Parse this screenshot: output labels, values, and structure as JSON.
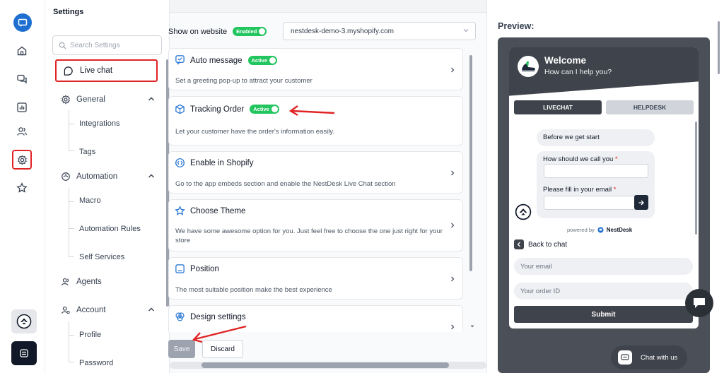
{
  "rail": {
    "items": [
      "logo-icon",
      "home-icon",
      "chat-icon",
      "reports-icon",
      "users-icon",
      "settings-icon",
      "star-icon"
    ]
  },
  "settings": {
    "title": "Settings",
    "search_placeholder": "Search Settings",
    "nav": {
      "live_chat": "Live chat",
      "general": "General",
      "integrations": "Integrations",
      "tags": "Tags",
      "automation": "Automation",
      "macro": "Macro",
      "automation_rules": "Automation Rules",
      "self_services": "Self Services",
      "agents": "Agents",
      "account": "Account",
      "profile": "Profile",
      "password": "Password"
    }
  },
  "main": {
    "show_on_website": "Show on website",
    "enabled_toggle": "Enabled",
    "store_url": "nestdesk-demo-3.myshopify.com",
    "cards": [
      {
        "title": "Auto message",
        "badge": "Active",
        "desc": "Set a greeting pop-up to attract your customer"
      },
      {
        "title": "Tracking Order",
        "badge": "Active",
        "desc": "Let your customer have the order's information easily."
      },
      {
        "title": "Enable in Shopify",
        "desc": "Go to the app embeds section and enable the NestDesk Live Chat section"
      },
      {
        "title": "Choose Theme",
        "desc": "We have some awesome option for you. Just feel free to choose the one just right for your store"
      },
      {
        "title": "Position",
        "desc": "The most suitable position make the best experience"
      },
      {
        "title": "Design settings"
      }
    ],
    "save": "Save",
    "discard": "Discard"
  },
  "preview": {
    "label": "Preview:",
    "welcome": "Welcome",
    "help": "How can I help you?",
    "tab_livechat": "LIVECHAT",
    "tab_helpdesk": "HELPDESK",
    "before_start": "Before we get start",
    "name_question": "How should we call you",
    "email_question": "Please fill in your email",
    "required_mark": "*",
    "powered_by": "powered by",
    "brand": "NestDesk",
    "back_to_chat": "Back to chat",
    "email_placeholder": "Your email",
    "order_placeholder": "Your order ID",
    "submit": "Submit",
    "chat_with_us": "Chat with us"
  },
  "colors": {
    "accent_green": "#22c55e",
    "highlight_red": "#e02424",
    "widget_dark": "#3f434b",
    "brand_blue": "#1f6fd1"
  }
}
